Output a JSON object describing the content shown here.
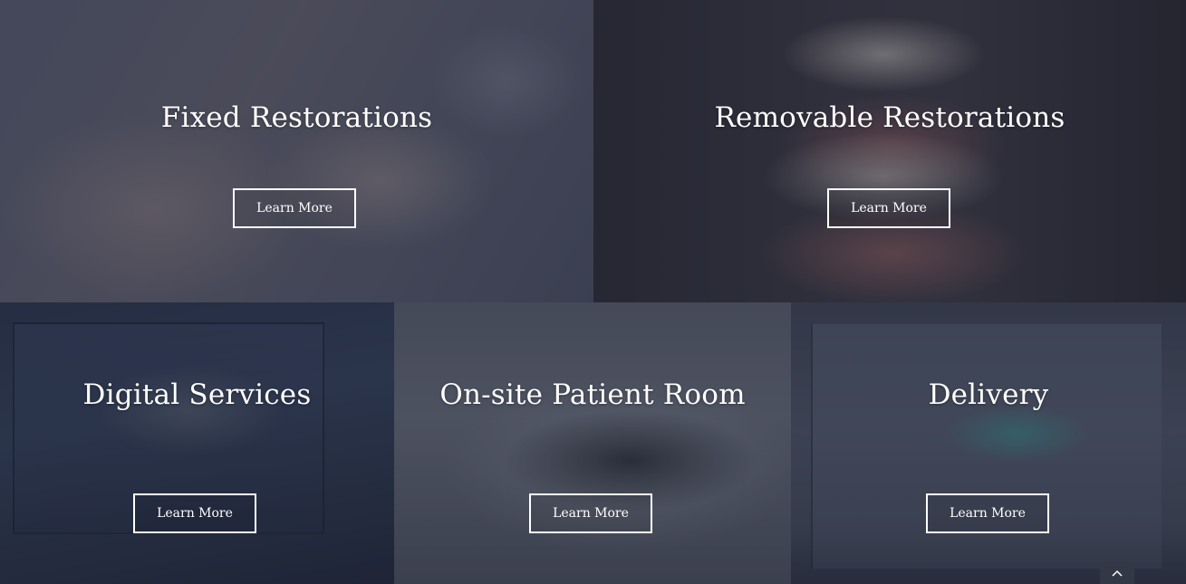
{
  "services": [
    {
      "title": "Fixed Restorations",
      "button_label": "Learn More"
    },
    {
      "title": "Removable Restorations",
      "button_label": "Learn More"
    },
    {
      "title": "Digital Services",
      "button_label": "Learn More"
    },
    {
      "title": "On-site Patient Room",
      "button_label": "Learn More"
    },
    {
      "title": "Delivery",
      "button_label": "Learn More"
    }
  ],
  "scroll_top": {
    "icon": "chevron-up-icon"
  },
  "colors": {
    "text": "#ffffff",
    "button_border": "#ffffff",
    "overlay": "#2d3244"
  }
}
